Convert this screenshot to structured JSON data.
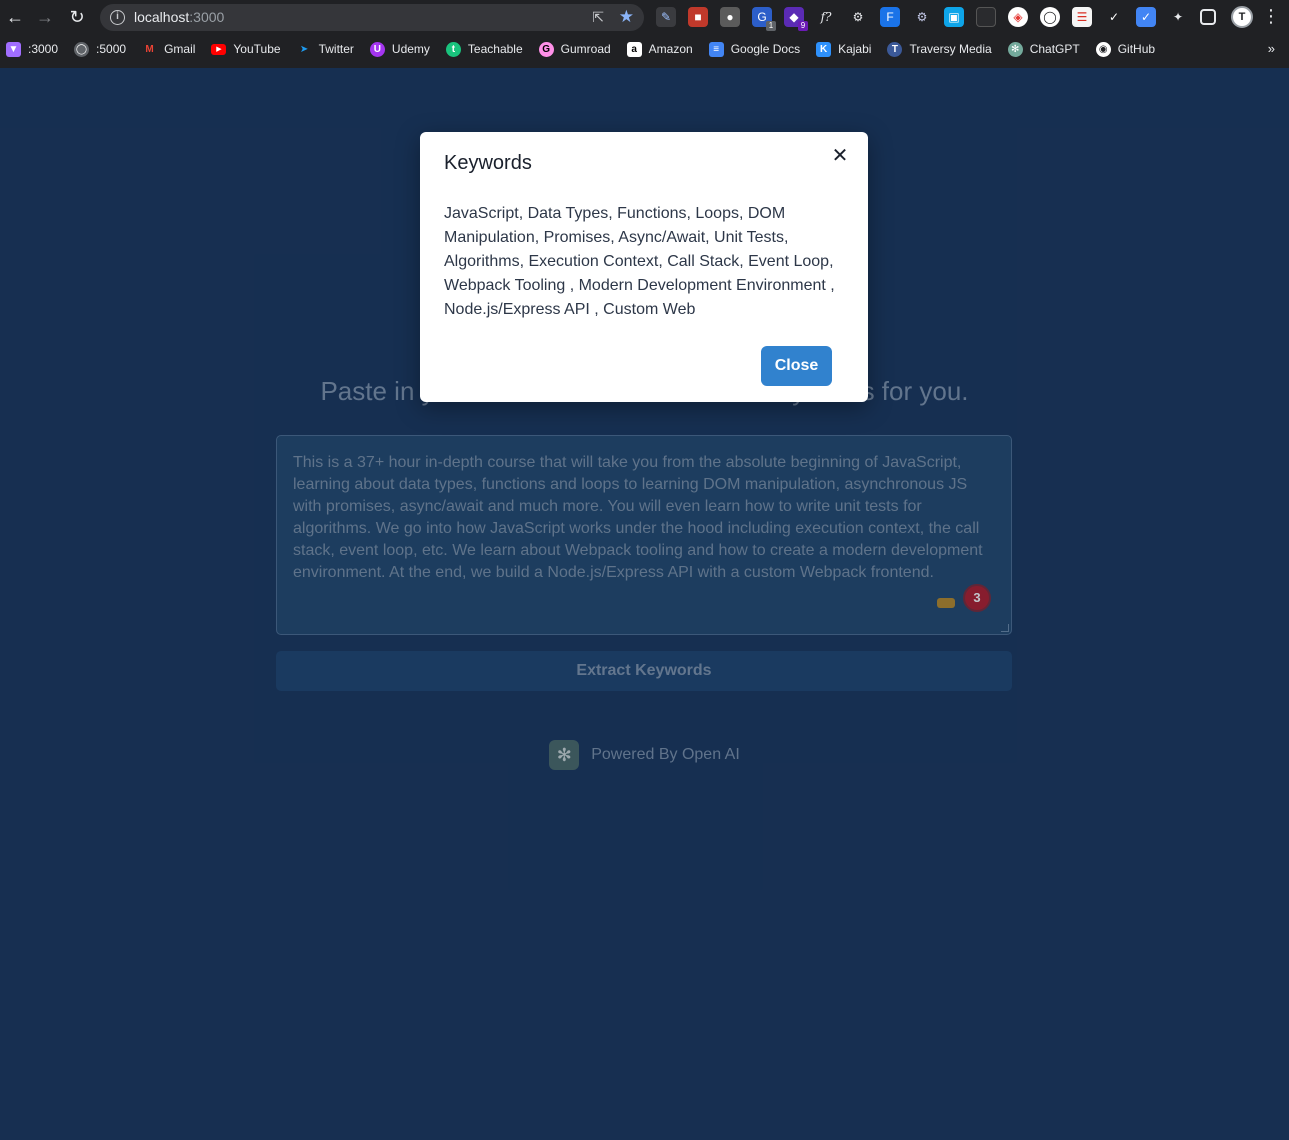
{
  "browser": {
    "url_host": "localhost",
    "url_port": ":3000",
    "profile_initial": "T",
    "extension_badges": [
      "1",
      "9"
    ],
    "bookmarks": [
      {
        "label": ":3000",
        "icon": "vite-icon",
        "color": "#a16eff"
      },
      {
        "label": ":5000",
        "icon": "globe-icon",
        "color": "#5f6368"
      },
      {
        "label": "Gmail",
        "icon": "gmail-icon",
        "color": "#ea4335"
      },
      {
        "label": "YouTube",
        "icon": "youtube-icon",
        "color": "#ff0000"
      },
      {
        "label": "Twitter",
        "icon": "twitter-icon",
        "color": "#1d9bf0"
      },
      {
        "label": "Udemy",
        "icon": "udemy-icon",
        "color": "#a435f0"
      },
      {
        "label": "Teachable",
        "icon": "teachable-icon",
        "color": "#19c37d"
      },
      {
        "label": "Gumroad",
        "icon": "gumroad-icon",
        "color": "#ff90e8"
      },
      {
        "label": "Amazon",
        "icon": "amazon-icon",
        "color": "#ffffff"
      },
      {
        "label": "Google Docs",
        "icon": "google-docs-icon",
        "color": "#4285f4"
      },
      {
        "label": "Kajabi",
        "icon": "kajabi-icon",
        "color": "#2e91fc"
      },
      {
        "label": "Traversy Media",
        "icon": "traversy-media-icon",
        "color": "#3b5998"
      },
      {
        "label": "ChatGPT",
        "icon": "chatgpt-icon",
        "color": "#74aa9c"
      },
      {
        "label": "GitHub",
        "icon": "github-icon",
        "color": "#ffffff"
      }
    ]
  },
  "page": {
    "heading": "Paste in your text and we'll extract the keywords for you.",
    "textarea_value": "This is a 37+ hour in-depth course that will take you from the absolute beginning of JavaScript, learning about data types, functions and loops to learning DOM manipulation, asynchronous JS with promises, async/await and much more. You will even learn how to write unit tests for algorithms. We go into how JavaScript works under the hood including execution context, the call stack, event loop, etc. We learn about Webpack tooling and how to create a modern development environment. At the end, we build a Node.js/Express API with a custom Webpack frontend.",
    "textarea_badge": "3",
    "extract_button": "Extract Keywords",
    "powered_by": "Powered By Open AI"
  },
  "modal": {
    "title": "Keywords",
    "keywords": "JavaScript, Data Types, Functions, Loops, DOM Manipulation, Promises, Async/Await, Unit Tests, Algorithms, Execution Context, Call Stack, Event Loop, Webpack Tooling , Modern Development Environment , Node.js/Express API , Custom Web",
    "close_button": "Close"
  }
}
